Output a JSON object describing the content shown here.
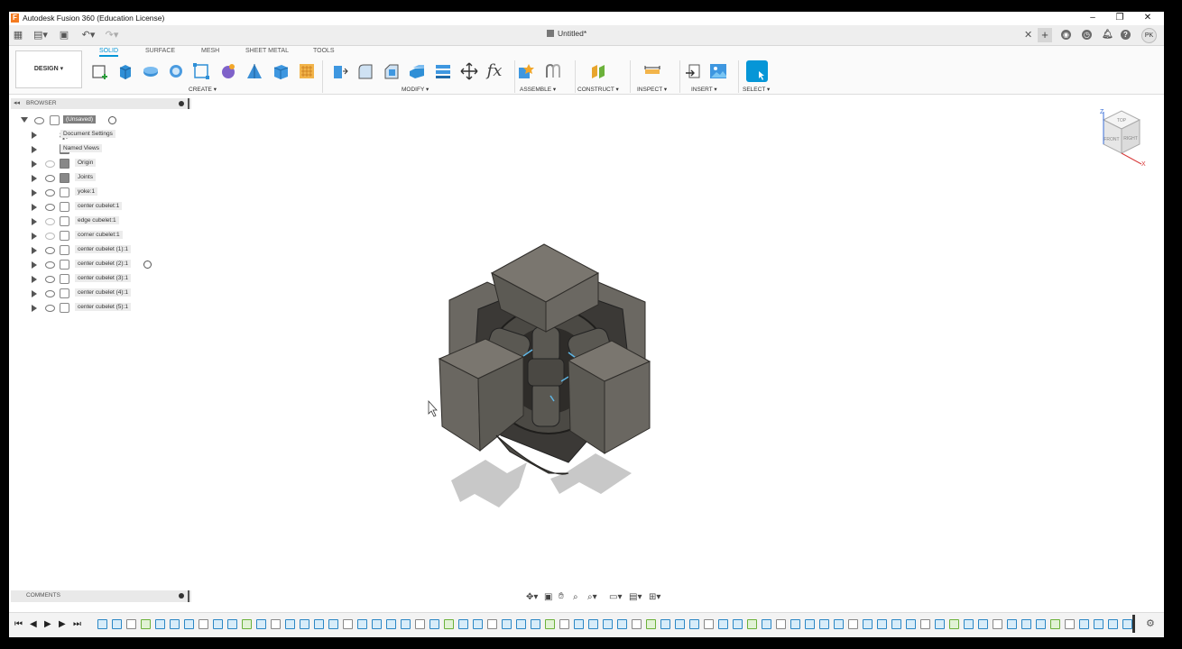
{
  "window": {
    "title": "Autodesk Fusion 360 (Education License)"
  },
  "document": {
    "tab_title": "Untitled*",
    "avatar_initials": "PK"
  },
  "toolbar": {
    "workspace": "DESIGN ▾",
    "tabs": [
      "SOLID",
      "SURFACE",
      "MESH",
      "SHEET METAL",
      "TOOLS"
    ],
    "groups": {
      "create": "CREATE ▾",
      "modify": "MODIFY ▾",
      "assemble": "ASSEMBLE ▾",
      "construct": "CONSTRUCT ▾",
      "inspect": "INSPECT ▾",
      "insert": "INSERT ▾",
      "select": "SELECT ▾"
    },
    "fx_label": "fx"
  },
  "browser": {
    "title": "BROWSER",
    "root": "(Unsaved)",
    "items": [
      {
        "label": "Document Settings",
        "icon": "gear-icon"
      },
      {
        "label": "Named Views",
        "icon": "folder-icon"
      },
      {
        "label": "Origin",
        "icon": "folder-icon"
      },
      {
        "label": "Joints",
        "icon": "folder-icon"
      },
      {
        "label": "yoke:1",
        "icon": "component-icon"
      },
      {
        "label": "center cubelet:1",
        "icon": "component-icon"
      },
      {
        "label": "edge cubelet:1",
        "icon": "component-icon"
      },
      {
        "label": "corner cubelet:1",
        "icon": "component-icon"
      },
      {
        "label": "center cubelet (1):1",
        "icon": "component-icon"
      },
      {
        "label": "center cubelet (2):1",
        "icon": "component-icon"
      },
      {
        "label": "center cubelet (3):1",
        "icon": "component-icon"
      },
      {
        "label": "center cubelet (4):1",
        "icon": "component-icon"
      },
      {
        "label": "center cubelet (5):1",
        "icon": "component-icon"
      }
    ]
  },
  "comments": {
    "title": "COMMENTS"
  },
  "viewcube": {
    "top": "TOP",
    "front": "FRONT",
    "right": "RIGHT",
    "axis_z": "Z",
    "axis_x": "X"
  },
  "colors": {
    "accent": "#0696d7",
    "model": "#6d6a63",
    "model_dark": "#4a4843"
  }
}
